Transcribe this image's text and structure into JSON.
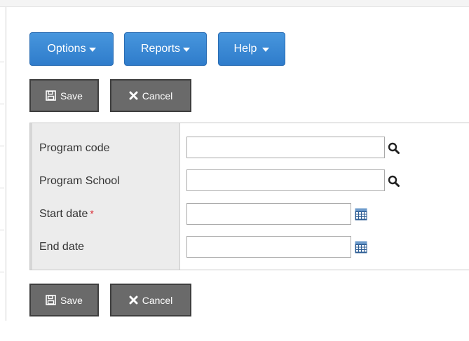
{
  "menu": {
    "options_label": "Options",
    "reports_label": "Reports",
    "help_label": "Help"
  },
  "actions": {
    "save_label": "Save",
    "cancel_label": "Cancel"
  },
  "form": {
    "program_code_label": "Program code",
    "program_code_value": "",
    "program_school_label": "Program School",
    "program_school_value": "",
    "start_date_label": "Start date",
    "start_date_required": "*",
    "start_date_value": "",
    "end_date_label": "End date",
    "end_date_value": ""
  },
  "colors": {
    "menu_button": "#3583d1",
    "action_button": "#6a6a6a",
    "required_marker": "#d9232d"
  },
  "icons": {
    "menu_caret": "caret-down-icon",
    "save": "floppy-disk-icon",
    "cancel": "x-icon",
    "lookup": "magnifier-icon",
    "date_picker": "calendar-grid-icon"
  }
}
